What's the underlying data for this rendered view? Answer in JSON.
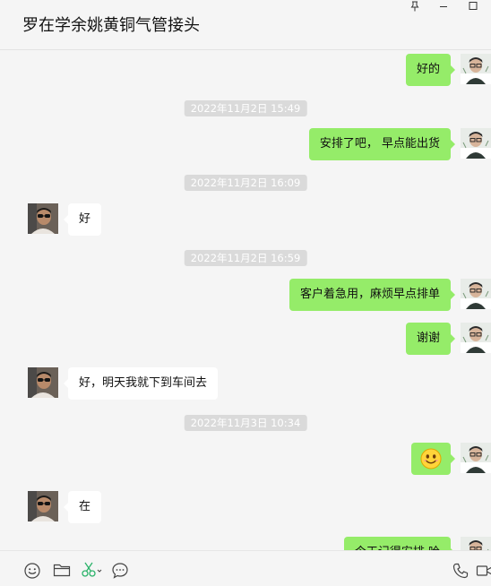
{
  "window": {
    "title": "罗在学余姚黄铜气管接头",
    "pin_icon": "pin-icon",
    "minimize_icon": "minimize-icon",
    "maximize_icon": "maximize-icon"
  },
  "colors": {
    "background": "#f5f5f5",
    "sent_bubble": "#95ec69",
    "received_bubble": "#ffffff",
    "timestamp_bg": "#dadada"
  },
  "messages": [
    {
      "type": "sent",
      "text": "好的"
    },
    {
      "type": "timestamp",
      "text": "2022年11月2日 15:49"
    },
    {
      "type": "sent",
      "text": "安排了吧， 早点能出货"
    },
    {
      "type": "timestamp",
      "text": "2022年11月2日 16:09"
    },
    {
      "type": "received",
      "text": "好"
    },
    {
      "type": "timestamp",
      "text": "2022年11月2日 16:59"
    },
    {
      "type": "sent",
      "text": "客户着急用，麻烦早点排单"
    },
    {
      "type": "sent",
      "text": "谢谢"
    },
    {
      "type": "received",
      "text": "好，明天我就下到车间去"
    },
    {
      "type": "timestamp",
      "text": "2022年11月3日 10:34"
    },
    {
      "type": "sent_emoji",
      "emoji": "smile-emoji"
    },
    {
      "type": "received",
      "text": "在"
    },
    {
      "type": "sent",
      "text": "今天记得安排 哈"
    }
  ],
  "toolbar": {
    "icons": [
      "emoji-icon",
      "folder-icon",
      "scissors-icon",
      "chat-bubble-icon",
      "phone-icon",
      "video-icon"
    ]
  }
}
